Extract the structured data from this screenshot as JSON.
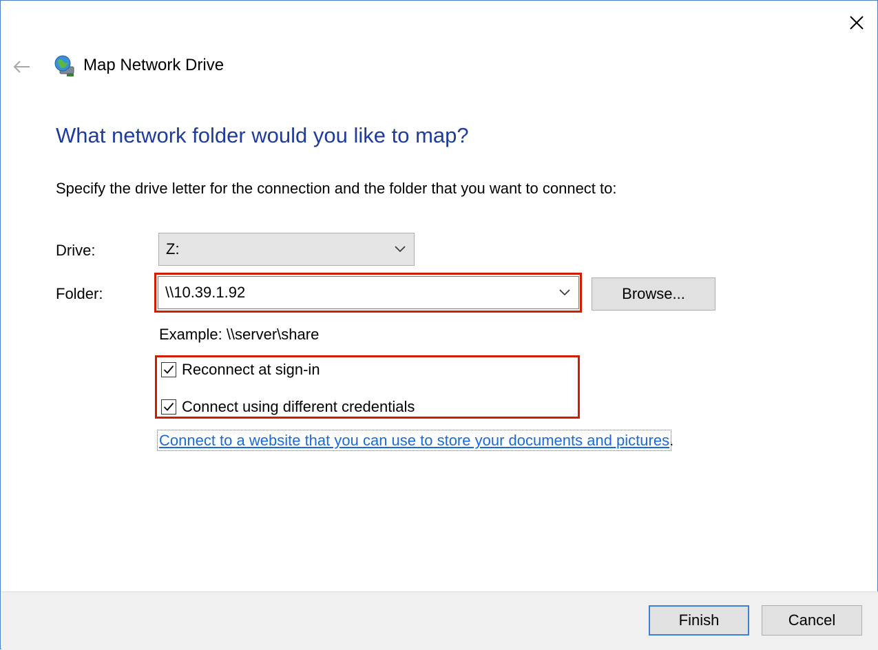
{
  "window": {
    "title": "Map Network Drive",
    "heading": "What network folder would you like to map?",
    "instruction": "Specify the drive letter for the connection and the folder that you want to connect to:"
  },
  "form": {
    "drive_label": "Drive:",
    "drive_value": "Z:",
    "folder_label": "Folder:",
    "folder_value": "\\\\10.39.1.92",
    "browse_label": "Browse...",
    "example_text": "Example: \\\\server\\share",
    "reconnect_label": "Reconnect at sign-in",
    "reconnect_checked": true,
    "credentials_label": "Connect using different credentials",
    "credentials_checked": true,
    "link_text": "Connect to a website that you can use to store your documents and pictures",
    "link_suffix": "."
  },
  "footer": {
    "finish_label": "Finish",
    "cancel_label": "Cancel"
  },
  "colors": {
    "heading": "#1e3c9c",
    "link": "#1a6ad6",
    "highlight": "#d11c00",
    "default_button_border": "#3c7fd4"
  },
  "icons": {
    "close": "close-icon",
    "back": "back-arrow-icon",
    "app": "network-drive-icon",
    "chevron": "chevron-down-icon",
    "check": "checkmark-icon"
  }
}
